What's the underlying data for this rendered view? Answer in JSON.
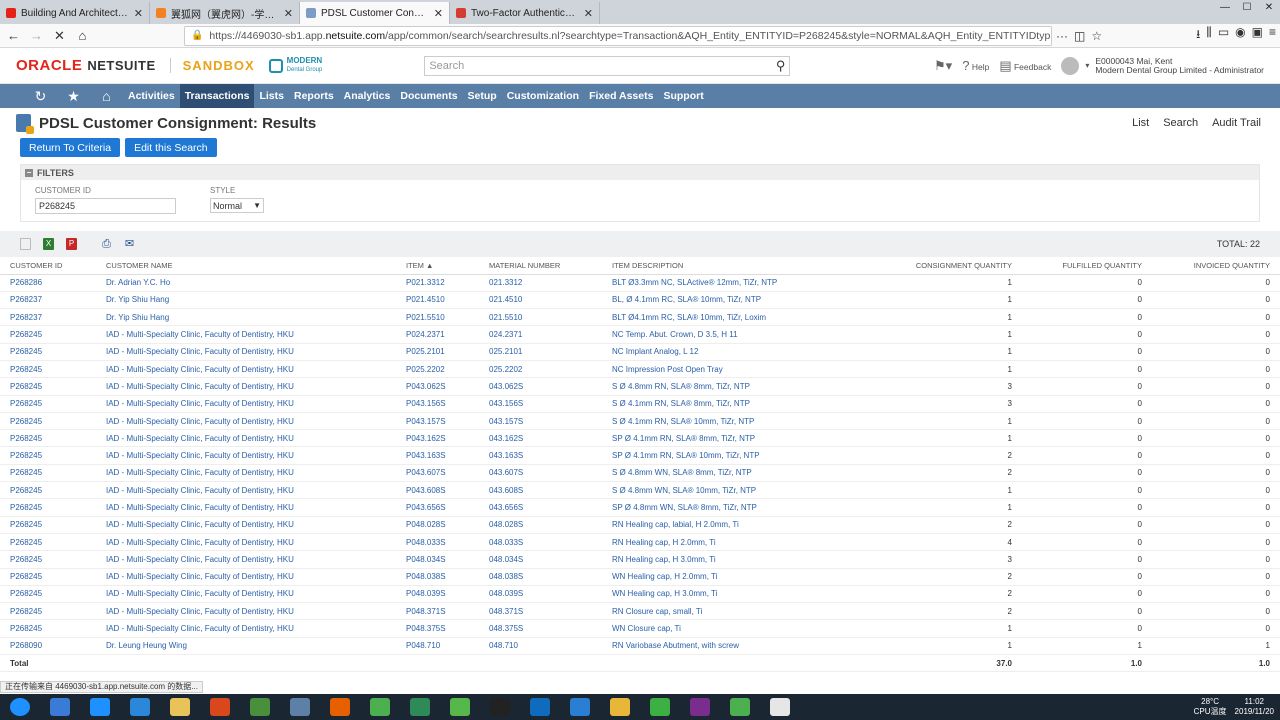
{
  "browser": {
    "tabs": [
      {
        "title": "Building And Architecting",
        "color": "#e62117",
        "active": false
      },
      {
        "title": "翼狐网（翼虎网）-学设计，上",
        "color": "#f48120",
        "active": false
      },
      {
        "title": "PDSL Customer Consignme",
        "color": "#7a9cc6",
        "active": true
      },
      {
        "title": "Two-Factor Authentication f",
        "color": "#d23f31",
        "active": false
      }
    ],
    "url_prefix": "https://4469030-sb1.app.",
    "url_domain": "netsuite.com",
    "url_rest": "/app/common/search/searchresults.nl?searchtype=Transaction&AQH_Entity_ENTITYID=P268245&style=NORMAL&AQH_Entity_ENTITYIDtyp"
  },
  "header": {
    "oracle": "ORACLE",
    "netsuite": "NETSUITE",
    "sandbox": "SANDBOX",
    "brand_line1": "MODERN",
    "brand_line2": "Dental Group",
    "search_placeholder": "Search",
    "help": "Help",
    "feedback": "Feedback",
    "user_name": "E0000043 Mai, Kent",
    "user_role": "Modern Dental Group Limited - Administrator"
  },
  "menu": [
    "Activities",
    "Transactions",
    "Lists",
    "Reports",
    "Analytics",
    "Documents",
    "Setup",
    "Customization",
    "Fixed Assets",
    "Support"
  ],
  "menu_active": "Transactions",
  "page": {
    "title": "PDSL Customer Consignment: Results",
    "links": [
      "List",
      "Search",
      "Audit Trail"
    ],
    "return_btn": "Return To Criteria",
    "edit_btn": "Edit this Search"
  },
  "filters": {
    "header": "FILTERS",
    "customer_id_label": "CUSTOMER ID",
    "customer_id_value": "P268245",
    "style_label": "STYLE",
    "style_value": "Normal"
  },
  "results": {
    "total_label": "TOTAL: 22",
    "columns": [
      "CUSTOMER ID",
      "CUSTOMER NAME",
      "ITEM ▲",
      "MATERIAL NUMBER",
      "ITEM DESCRIPTION",
      "CONSIGNMENT QUANTITY",
      "FULFILLED QUANTITY",
      "INVOICED QUANTITY"
    ],
    "rows": [
      [
        "P268286",
        "Dr. Adrian Y.C. Ho",
        "P021.3312",
        "021.3312",
        "BLT Ø3.3mm NC, SLActive® 12mm, TiZr, NTP",
        "1",
        "0",
        "0"
      ],
      [
        "P268237",
        "Dr. Yip Shiu Hang",
        "P021.4510",
        "021.4510",
        "BL, Ø 4.1mm RC, SLA® 10mm, TiZr, NTP",
        "1",
        "0",
        "0"
      ],
      [
        "P268237",
        "Dr. Yip Shiu Hang",
        "P021.5510",
        "021.5510",
        "BLT Ø4.1mm RC, SLA® 10mm, TiZr, Loxim",
        "1",
        "0",
        "0"
      ],
      [
        "P268245",
        "IAD - Multi-Specialty Clinic, Faculty of Dentistry, HKU",
        "P024.2371",
        "024.2371",
        "NC Temp. Abut. Crown, D 3.5, H 11",
        "1",
        "0",
        "0"
      ],
      [
        "P268245",
        "IAD - Multi-Specialty Clinic, Faculty of Dentistry, HKU",
        "P025.2101",
        "025.2101",
        "NC Implant Analog, L 12",
        "1",
        "0",
        "0"
      ],
      [
        "P268245",
        "IAD - Multi-Specialty Clinic, Faculty of Dentistry, HKU",
        "P025.2202",
        "025.2202",
        "NC Impression Post Open Tray",
        "1",
        "0",
        "0"
      ],
      [
        "P268245",
        "IAD - Multi-Specialty Clinic, Faculty of Dentistry, HKU",
        "P043.062S",
        "043.062S",
        "S Ø 4.8mm RN, SLA® 8mm, TiZr, NTP",
        "3",
        "0",
        "0"
      ],
      [
        "P268245",
        "IAD - Multi-Specialty Clinic, Faculty of Dentistry, HKU",
        "P043.156S",
        "043.156S",
        "S Ø 4.1mm RN, SLA® 8mm, TiZr, NTP",
        "3",
        "0",
        "0"
      ],
      [
        "P268245",
        "IAD - Multi-Specialty Clinic, Faculty of Dentistry, HKU",
        "P043.157S",
        "043.157S",
        "S Ø 4.1mm RN, SLA® 10mm, TiZr, NTP",
        "1",
        "0",
        "0"
      ],
      [
        "P268245",
        "IAD - Multi-Specialty Clinic, Faculty of Dentistry, HKU",
        "P043.162S",
        "043.162S",
        "SP Ø 4.1mm RN, SLA® 8mm, TiZr, NTP",
        "1",
        "0",
        "0"
      ],
      [
        "P268245",
        "IAD - Multi-Specialty Clinic, Faculty of Dentistry, HKU",
        "P043.163S",
        "043.163S",
        "SP Ø 4.1mm RN, SLA® 10mm, TiZr, NTP",
        "2",
        "0",
        "0"
      ],
      [
        "P268245",
        "IAD - Multi-Specialty Clinic, Faculty of Dentistry, HKU",
        "P043.607S",
        "043.607S",
        "S Ø 4.8mm WN, SLA® 8mm, TiZr, NTP",
        "2",
        "0",
        "0"
      ],
      [
        "P268245",
        "IAD - Multi-Specialty Clinic, Faculty of Dentistry, HKU",
        "P043.608S",
        "043.608S",
        "S Ø 4.8mm WN, SLA® 10mm, TiZr, NTP",
        "1",
        "0",
        "0"
      ],
      [
        "P268245",
        "IAD - Multi-Specialty Clinic, Faculty of Dentistry, HKU",
        "P043.656S",
        "043.656S",
        "SP Ø 4.8mm WN, SLA® 8mm, TiZr, NTP",
        "1",
        "0",
        "0"
      ],
      [
        "P268245",
        "IAD - Multi-Specialty Clinic, Faculty of Dentistry, HKU",
        "P048.028S",
        "048.028S",
        "RN Healing cap, labial, H 2.0mm, Ti",
        "2",
        "0",
        "0"
      ],
      [
        "P268245",
        "IAD - Multi-Specialty Clinic, Faculty of Dentistry, HKU",
        "P048.033S",
        "048.033S",
        "RN Healing cap, H 2.0mm, Ti",
        "4",
        "0",
        "0"
      ],
      [
        "P268245",
        "IAD - Multi-Specialty Clinic, Faculty of Dentistry, HKU",
        "P048.034S",
        "048.034S",
        "RN Healing cap, H 3.0mm, Ti",
        "3",
        "0",
        "0"
      ],
      [
        "P268245",
        "IAD - Multi-Specialty Clinic, Faculty of Dentistry, HKU",
        "P048.038S",
        "048.038S",
        "WN Healing cap, H 2.0mm, Ti",
        "2",
        "0",
        "0"
      ],
      [
        "P268245",
        "IAD - Multi-Specialty Clinic, Faculty of Dentistry, HKU",
        "P048.039S",
        "048.039S",
        "WN Healing cap, H 3.0mm, Ti",
        "2",
        "0",
        "0"
      ],
      [
        "P268245",
        "IAD - Multi-Specialty Clinic, Faculty of Dentistry, HKU",
        "P048.371S",
        "048.371S",
        "RN Closure cap, small, Ti",
        "2",
        "0",
        "0"
      ],
      [
        "P268245",
        "IAD - Multi-Specialty Clinic, Faculty of Dentistry, HKU",
        "P048.375S",
        "048.375S",
        "WN Closure cap, Ti",
        "1",
        "0",
        "0"
      ],
      [
        "P268090",
        "Dr. Leung Heung Wing",
        "P048.710",
        "048.710",
        "RN Variobase Abutment, with screw",
        "1",
        "1",
        "1"
      ]
    ],
    "total_row": {
      "label": "Total",
      "consignment": "37.0",
      "fulfilled": "1.0",
      "invoiced": "1.0"
    }
  },
  "statusbar": "正在传输来自 4469030-sb1.app.netsuite.com 的数据...",
  "taskbar": {
    "apps": [
      "#3a7bd5",
      "#1e90ff",
      "#2b88d8",
      "#e8c35a",
      "#d9481d",
      "#4a8f3c",
      "#5e7fa6",
      "#e66000",
      "#4caf50",
      "#2e8b57",
      "#56b84b",
      "#222222",
      "#0f6cbd",
      "#2a7fd3",
      "#e8b73a",
      "#3cb043",
      "#7b2d8e",
      "#4caf50",
      "#e6e6e6"
    ],
    "weather": "28°C",
    "weather_sub": "CPU温度",
    "time": "11:02",
    "date": "2019/11/20"
  }
}
